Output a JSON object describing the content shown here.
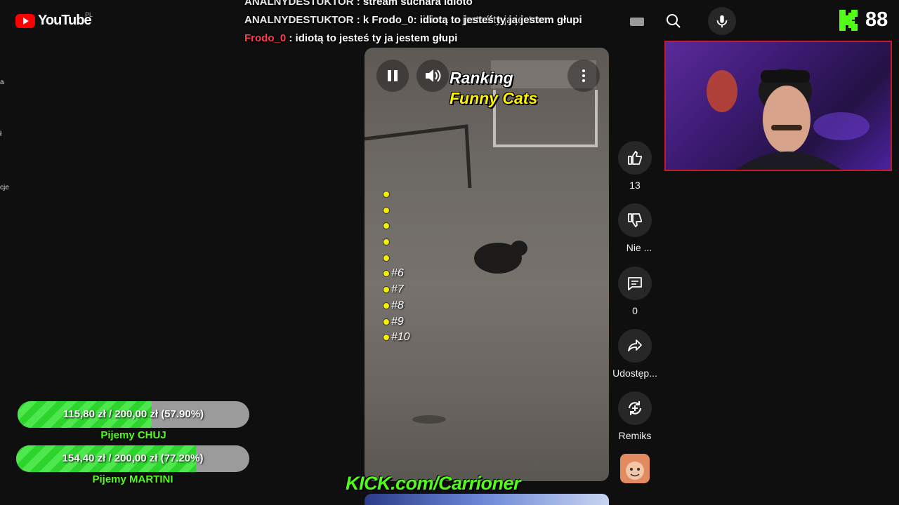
{
  "youtube": {
    "logo_text": "YouTube",
    "region": "PL"
  },
  "sidebar_fragments": [
    "a",
    "ł",
    "cje"
  ],
  "chat": [
    {
      "user": "ANALNYDESTUKTOR",
      "message": "stream suchara idioto"
    },
    {
      "user": "ANALNYDESTUKTOR",
      "message": "k Frodo_0: idiotą to jesteś ty ja jestem głupi"
    },
    {
      "user": "Frodo_0",
      "message": "idiotą to jesteś ty ja jestem głupi"
    }
  ],
  "search": {
    "text": "idiotą to jesteś ty ja jestem"
  },
  "icons": {
    "search": "search-icon",
    "mic": "mic-icon",
    "keyboard": "keyboard-icon"
  },
  "kick": {
    "viewer_count": "88",
    "url_text": "KICK.com/Carrioner",
    "brand_color": "#53fc18"
  },
  "video": {
    "title_line1": "Ranking",
    "title_line2": "Funny Cats",
    "ranking": [
      "",
      "",
      "",
      "",
      "",
      "#6",
      "#7",
      "#8",
      "#9",
      "#10"
    ]
  },
  "actions": {
    "like_count": "13",
    "dislike_label": "Nie ...",
    "comment_count": "0",
    "share_label": "Udostęp...",
    "remix_label": "Remiks"
  },
  "goals": [
    {
      "text": "115,80 zł / 200,00 zł (57.90%)",
      "fraction": 0.579,
      "name": "Pijemy CHUJ"
    },
    {
      "text": "154,40 zł / 200,00 zł (77.20%)",
      "fraction": 0.772,
      "name": "Pijemy MARTINI"
    }
  ]
}
